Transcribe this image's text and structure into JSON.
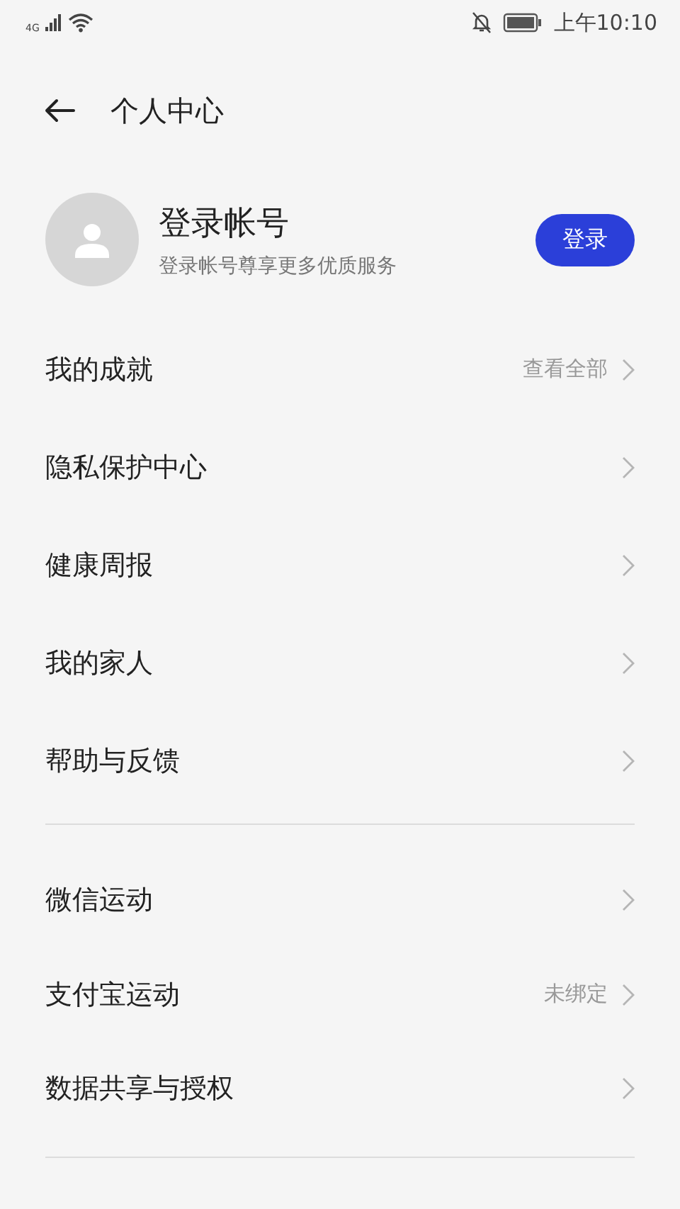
{
  "status_bar": {
    "network": "4G",
    "time": "上午10:10"
  },
  "header": {
    "title": "个人中心"
  },
  "profile": {
    "name": "登录帐号",
    "subtitle": "登录帐号尊享更多优质服务",
    "login_button": "登录"
  },
  "sections": [
    {
      "items": [
        {
          "label": "我的成就",
          "value": "查看全部"
        },
        {
          "label": "隐私保护中心"
        },
        {
          "label": "健康周报"
        },
        {
          "label": "我的家人"
        },
        {
          "label": "帮助与反馈"
        }
      ]
    },
    {
      "items": [
        {
          "label": "微信运动"
        },
        {
          "label": "支付宝运动",
          "value": "未绑定"
        },
        {
          "label": "数据共享与授权"
        }
      ]
    }
  ]
}
